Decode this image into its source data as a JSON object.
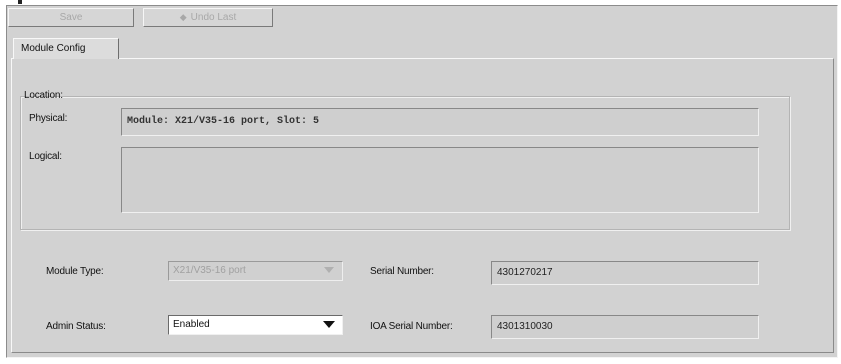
{
  "toolbar": {
    "save_label": "Save",
    "undo_label": "Undo Last",
    "undo_icon": "arrow-icon"
  },
  "tabs": [
    {
      "label": "Module Config",
      "selected": true
    }
  ],
  "location": {
    "title": "Location:",
    "physical_label": "Physical:",
    "physical_value": "Module: X21/V35-16 port, Slot: 5",
    "logical_label": "Logical:",
    "logical_value": ""
  },
  "module": {
    "type_label": "Module Type:",
    "type_value": "X21/V35-16 port",
    "admin_status_label": "Admin Status:",
    "admin_status_value": "Enabled",
    "serial_label": "Serial Number:",
    "serial_value": "4301270217",
    "ioa_serial_label": "IOA Serial Number:",
    "ioa_serial_value": "4301310030"
  },
  "colors": {
    "panel_bg": "#d2d2d2",
    "disabled_text": "#a8a8a8"
  }
}
